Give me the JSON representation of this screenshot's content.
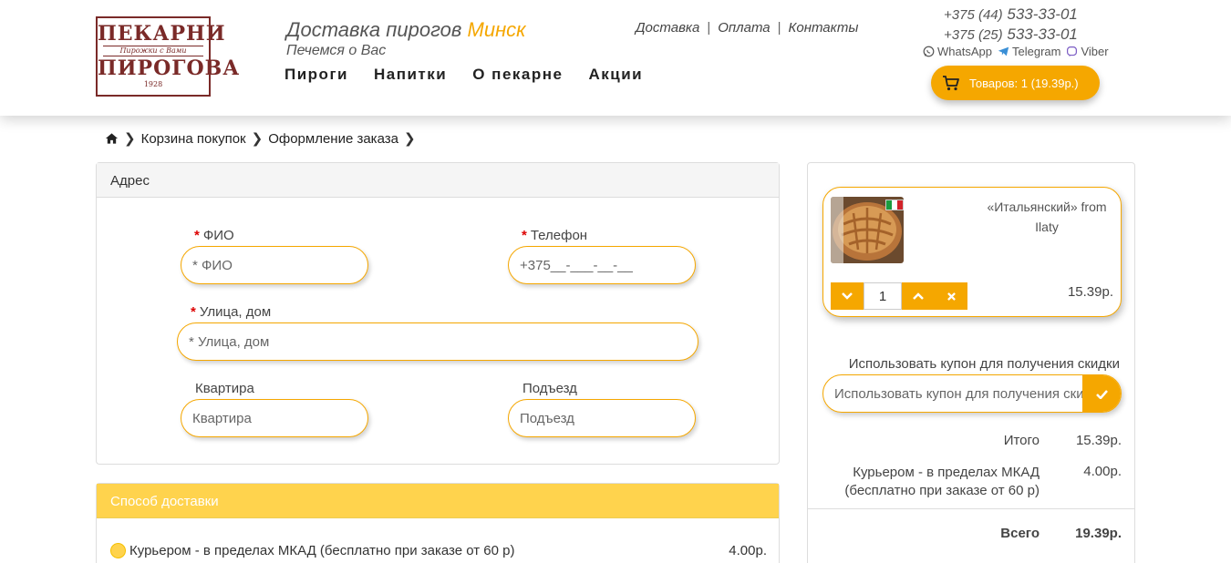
{
  "header": {
    "logo_top": "ПЕКАРНИ",
    "logo_mid": "Пирожки с Вами",
    "logo_bottom": "ПИРОГОВА",
    "logo_year": "1928",
    "tagline": "Доставка пирогов ",
    "tagline_city": "Минск",
    "subtagline": "Печемся о Вас",
    "main_nav": [
      "Пироги",
      "Напитки",
      "О пекарне",
      "Акции"
    ],
    "top_nav": [
      "Доставка",
      "Оплата",
      "Контакты"
    ],
    "phones": [
      {
        "code": "+375 (44)",
        "number": "533-33-01"
      },
      {
        "code": "+375 (25)",
        "number": "533-33-01"
      }
    ],
    "messengers": [
      "WhatsApp",
      "Telegram",
      "Viber"
    ],
    "cart_label": "Товаров: 1 (19.39р.)"
  },
  "breadcrumb": [
    "Корзина покупок",
    "Оформление заказа"
  ],
  "address": {
    "title": "Адрес",
    "fio_label": "ФИО",
    "fio_placeholder": "* ФИО",
    "phone_label": "Телефон",
    "phone_placeholder": "+375__-___-__-__",
    "street_label": "Улица, дом",
    "street_placeholder": "* Улица, дом",
    "apt_label": "Квартира",
    "apt_placeholder": "Квартира",
    "entrance_label": "Подъезд",
    "entrance_placeholder": "Подъезд",
    "required_mark": "*"
  },
  "delivery": {
    "title": "Способ доставки",
    "option_label": "Курьером - в пределах МКАД (бесплатно при заказе от 60 р)",
    "option_price": "4.00р."
  },
  "cart": {
    "product_name_line1": "«Итальянский» from",
    "product_name_line2": "Ilaty",
    "quantity": "1",
    "product_price": "15.39р.",
    "coupon_label": "Использовать купон для получения скидки",
    "coupon_placeholder": "Использовать купон для получения скидки",
    "subtotal_label": "Итого",
    "subtotal_value": "15.39р.",
    "shipping_label_line1": "Курьером - в пределах МКАД",
    "shipping_label_line2": "(бесплатно при заказе от 60 р)",
    "shipping_value": "4.00р.",
    "total_label": "Всего",
    "total_value": "19.39р."
  },
  "colors": {
    "accent": "#f5a700",
    "delivery_header": "#ffd34d",
    "logo": "#7a2a28"
  }
}
